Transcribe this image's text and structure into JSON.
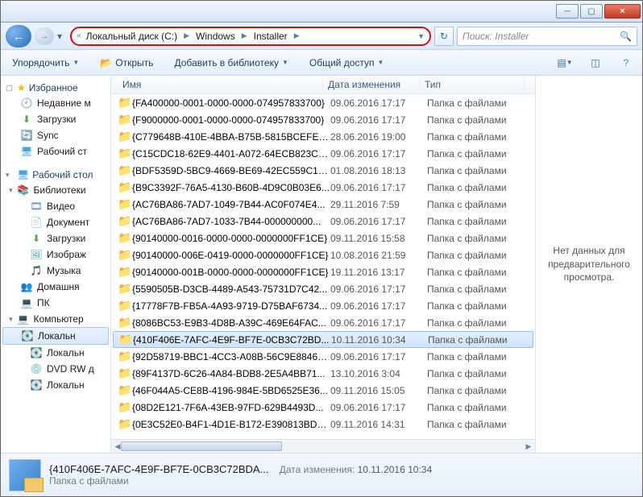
{
  "window": {
    "title": ""
  },
  "breadcrumb": {
    "seg1": "Локальный диск (C:)",
    "seg2": "Windows",
    "seg3": "Installer"
  },
  "search": {
    "placeholder": "Поиск: Installer"
  },
  "toolbar": {
    "organize": "Упорядочить",
    "open": "Открыть",
    "add_lib": "Добавить в библиотеку",
    "share": "Общий доступ"
  },
  "sidebar": {
    "favs": "Избранное",
    "recent": "Недавние м",
    "downloads": "Загрузки",
    "sync": "Sync",
    "desktop": "Рабочий ст",
    "desktop2": "Рабочий стол",
    "libraries": "Библиотеки",
    "video": "Видео",
    "documents": "Документ",
    "downloads2": "Загрузки",
    "images": "Изображ",
    "music": "Музыка",
    "home": "Домашня",
    "pc": "ПК",
    "computer": "Компьютер",
    "local": "Локальн",
    "local2": "Локальн",
    "dvd": "DVD RW д",
    "local3": "Локальн"
  },
  "columns": {
    "name": "Имя",
    "date": "Дата изменения",
    "type": "Тип"
  },
  "type_label": "Папка с файлами",
  "rows": [
    {
      "name": "{FA400000-0001-0000-0000-074957833700}",
      "date": "09.06.2016 17:17"
    },
    {
      "name": "{F9000000-0001-0000-0000-074957833700}",
      "date": "09.06.2016 17:17"
    },
    {
      "name": "{C779648B-410E-4BBA-B75B-5815BCEFE7...",
      "date": "28.06.2016 19:00"
    },
    {
      "name": "{C15CDC18-62E9-4401-A072-64ECB823CE...",
      "date": "09.06.2016 17:17"
    },
    {
      "name": "{BDF5359D-5BC9-4669-BE69-42EC559C19...",
      "date": "01.08.2016 18:13"
    },
    {
      "name": "{B9C3392F-76A5-4130-B60B-4D9C0B03E6...",
      "date": "09.06.2016 17:17"
    },
    {
      "name": "{AC76BA86-7AD7-1049-7B44-AC0F074E4...",
      "date": "29.11.2016 7:59"
    },
    {
      "name": "{AC76BA86-7AD7-1033-7B44-000000000...",
      "date": "09.06.2016 17:17"
    },
    {
      "name": "{90140000-0016-0000-0000-0000000FF1CE}",
      "date": "09.11.2016 15:58"
    },
    {
      "name": "{90140000-006E-0419-0000-0000000FF1CE}",
      "date": "10.08.2016 21:59"
    },
    {
      "name": "{90140000-001B-0000-0000-0000000FF1CE}",
      "date": "19.11.2016 13:17"
    },
    {
      "name": "{5590505B-D3CB-4489-A543-75731D7C42...",
      "date": "09.06.2016 17:17"
    },
    {
      "name": "{17778F7B-FB5A-4A93-9719-D75BAF6734...",
      "date": "09.06.2016 17:17"
    },
    {
      "name": "{8086BC53-E9B3-4D8B-A39C-469E64FAC...",
      "date": "09.06.2016 17:17"
    },
    {
      "name": "{410F406E-7AFC-4E9F-BF7E-0CB3C72BD...",
      "date": "10.11.2016 10:34",
      "selected": true
    },
    {
      "name": "{92D58719-BBC1-4CC3-A08B-56C9E88462...",
      "date": "09.06.2016 17:17"
    },
    {
      "name": "{89F4137D-6C26-4A84-BDB8-2E5A4BB71...",
      "date": "13.10.2016 3:04"
    },
    {
      "name": "{46F044A5-CE8B-4196-984E-5BD6525E36...",
      "date": "09.11.2016 15:05"
    },
    {
      "name": "{08D2E121-7F6A-43EB-97FD-629B4493D...",
      "date": "09.06.2016 17:17"
    },
    {
      "name": "{0E3C52E0-B4F1-4D1E-B172-E390813BD9...",
      "date": "09.11.2016 14:31"
    }
  ],
  "preview": {
    "text": "Нет данных для предварительного просмотра."
  },
  "details": {
    "name": "{410F406E-7AFC-4E9F-BF7E-0CB3C72BDA...",
    "date_label": "Дата изменения:",
    "date_val": "10.11.2016 10:34",
    "type": "Папка с файлами"
  }
}
